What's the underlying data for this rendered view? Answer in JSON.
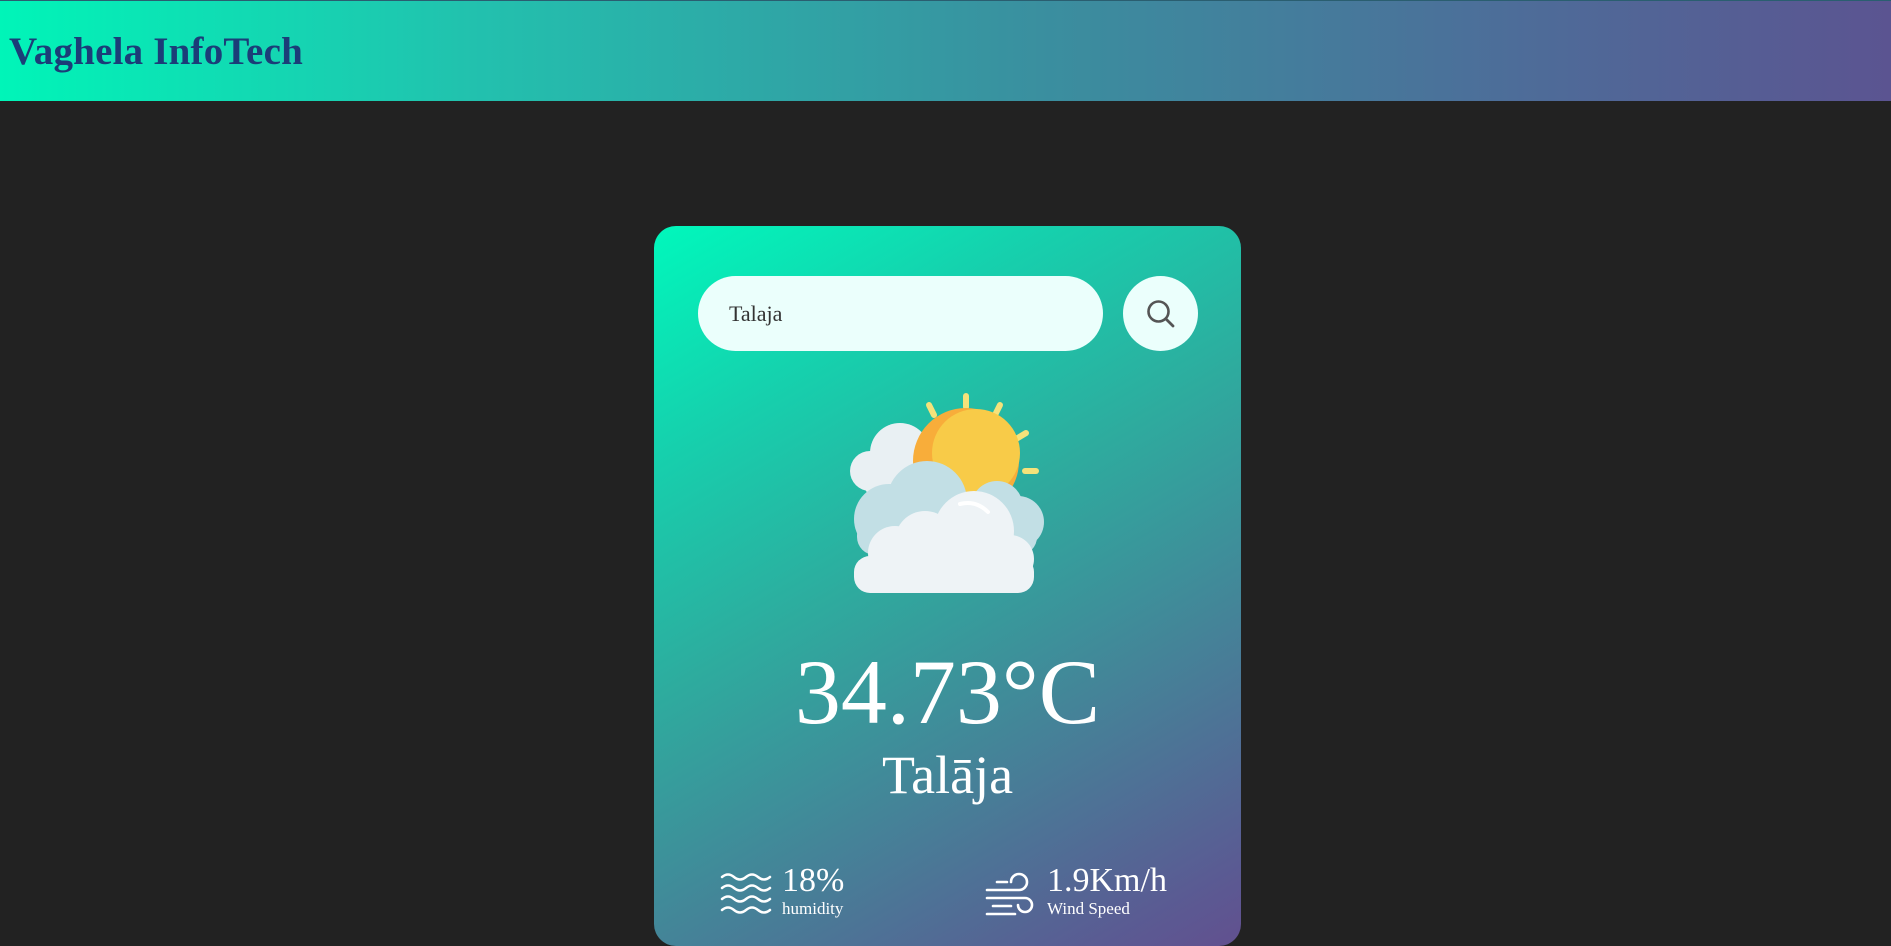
{
  "header": {
    "brand": "Vaghela InfoTech"
  },
  "search": {
    "value": "Talaja",
    "button_icon": "search-icon"
  },
  "weather": {
    "icon": "partly-cloudy-icon",
    "temperature": "34.73°C",
    "city": "Talāja"
  },
  "details": {
    "humidity": {
      "value": "18%",
      "label": "humidity",
      "icon": "humidity-icon"
    },
    "wind": {
      "value": "1.9Km/h",
      "label": "Wind Speed",
      "icon": "wind-icon"
    }
  },
  "colors": {
    "page_background": "#222222",
    "brand_text": "#1b3d78",
    "gradient_start": "#00f5b8",
    "gradient_end": "#5b5491",
    "input_background": "#ebfffc",
    "card_text": "#ffffff"
  }
}
